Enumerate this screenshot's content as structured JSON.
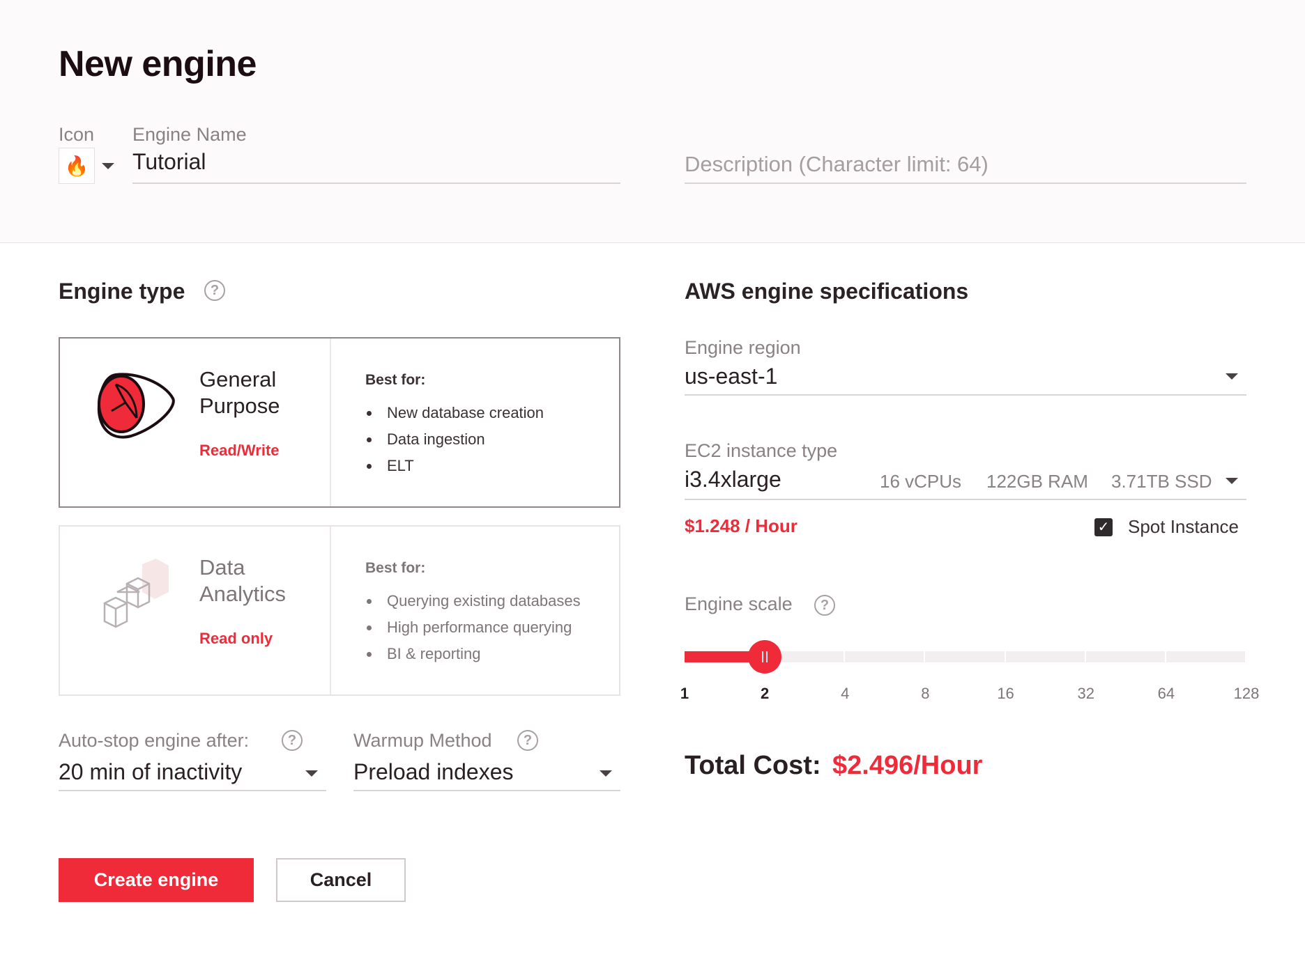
{
  "header": {
    "title": "New engine",
    "icon_label": "Icon",
    "icon_value": "🔥",
    "name_label": "Engine Name",
    "name_value": "Tutorial",
    "description_placeholder": "Description (Character limit: 64)"
  },
  "engine_type": {
    "heading": "Engine type",
    "help": "?",
    "cards": [
      {
        "name_line1": "General",
        "name_line2": "Purpose",
        "mode": "Read/Write",
        "best_for_label": "Best for:",
        "items": [
          "New database creation",
          "Data ingestion",
          "ELT"
        ],
        "selected": true
      },
      {
        "name_line1": "Data",
        "name_line2": "Analytics",
        "mode": "Read only",
        "best_for_label": "Best for:",
        "items": [
          "Querying existing databases",
          "High performance querying",
          "BI & reporting"
        ],
        "selected": false
      }
    ]
  },
  "auto_stop": {
    "label": "Auto-stop engine after:",
    "help": "?",
    "value": "20 min of inactivity"
  },
  "warmup": {
    "label": "Warmup Method",
    "help": "?",
    "value": "Preload indexes"
  },
  "aws": {
    "heading": "AWS engine specifications",
    "region_label": "Engine region",
    "region_value": "us-east-1",
    "instance_label": "EC2 instance type",
    "instance_value": "i3.4xlarge",
    "vcpus": "16 vCPUs",
    "ram": "122GB RAM",
    "ssd": "3.71TB SSD",
    "price": "$1.248 / Hour",
    "spot_label": "Spot Instance",
    "spot_checked": true,
    "scale_label": "Engine scale",
    "scale_help": "?",
    "scale_ticks": [
      "1",
      "2",
      "4",
      "8",
      "16",
      "32",
      "64",
      "128"
    ],
    "scale_value": "2",
    "total_label": "Total Cost:",
    "total_value": "$2.496/Hour"
  },
  "actions": {
    "create": "Create engine",
    "cancel": "Cancel"
  },
  "colors": {
    "accent": "#ef2b3a",
    "text": "#2a2024",
    "muted": "#8a8185"
  }
}
